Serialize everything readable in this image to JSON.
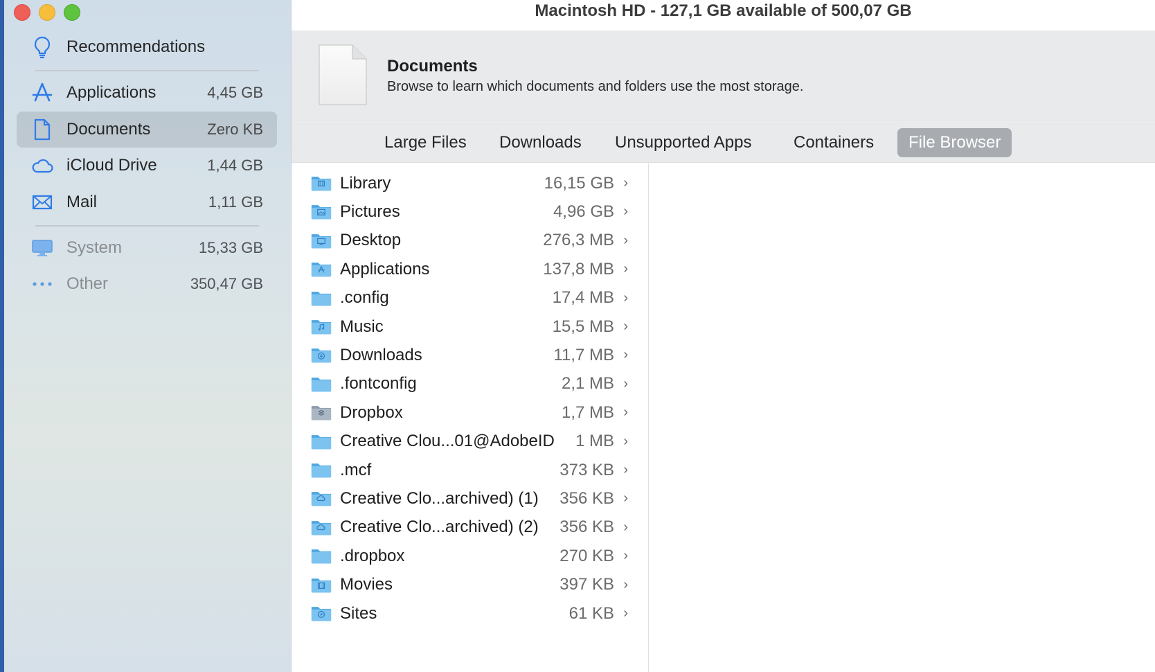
{
  "window": {
    "title": "Macintosh HD - 127,1 GB available of 500,07 GB"
  },
  "sidebar": {
    "recommendations": "Recommendations",
    "items": [
      {
        "label": "Applications",
        "size": "4,45 GB",
        "icon": "app-store-icon"
      },
      {
        "label": "Documents",
        "size": "Zero KB",
        "icon": "document-icon",
        "selected": true
      },
      {
        "label": "iCloud Drive",
        "size": "1,44 GB",
        "icon": "cloud-icon"
      },
      {
        "label": "Mail",
        "size": "1,11 GB",
        "icon": "envelope-icon"
      }
    ],
    "system_items": [
      {
        "label": "System",
        "size": "15,33 GB",
        "icon": "monitor-icon"
      },
      {
        "label": "Other",
        "size": "350,47 GB",
        "icon": "ellipsis-icon"
      }
    ]
  },
  "header": {
    "title": "Documents",
    "subtitle": "Browse to learn which documents and folders use the most storage."
  },
  "tabs": [
    {
      "label": "Large Files"
    },
    {
      "label": "Downloads"
    },
    {
      "label": "Unsupported Apps"
    },
    {
      "label": "Containers"
    },
    {
      "label": "File Browser",
      "active": true
    }
  ],
  "files": [
    {
      "name": "Library",
      "size": "16,15 GB",
      "icon": "library-folder-icon"
    },
    {
      "name": "Pictures",
      "size": "4,96 GB",
      "icon": "pictures-folder-icon"
    },
    {
      "name": "Desktop",
      "size": "276,3 MB",
      "icon": "desktop-folder-icon"
    },
    {
      "name": "Applications",
      "size": "137,8 MB",
      "icon": "applications-folder-icon"
    },
    {
      "name": ".config",
      "size": "17,4 MB",
      "icon": "folder-icon"
    },
    {
      "name": "Music",
      "size": "15,5 MB",
      "icon": "music-folder-icon"
    },
    {
      "name": "Downloads",
      "size": "11,7 MB",
      "icon": "downloads-folder-icon"
    },
    {
      "name": ".fontconfig",
      "size": "2,1 MB",
      "icon": "folder-icon"
    },
    {
      "name": "Dropbox",
      "size": "1,7 MB",
      "icon": "dropbox-folder-icon"
    },
    {
      "name": "Creative Clou...01@AdobeID",
      "size": "1 MB",
      "icon": "folder-icon"
    },
    {
      "name": ".mcf",
      "size": "373 KB",
      "icon": "folder-icon"
    },
    {
      "name": "Creative Clo...archived) (1)",
      "size": "356 KB",
      "icon": "creative-cloud-folder-icon"
    },
    {
      "name": "Creative Clo...archived) (2)",
      "size": "356 KB",
      "icon": "creative-cloud-folder-icon"
    },
    {
      "name": ".dropbox",
      "size": "270 KB",
      "icon": "folder-icon"
    },
    {
      "name": "Movies",
      "size": "397 KB",
      "icon": "movies-folder-icon"
    },
    {
      "name": "Sites",
      "size": "61 KB",
      "icon": "sites-folder-icon"
    }
  ],
  "chevron": "›",
  "colors": {
    "accent": "#2f7be8",
    "folder": "#6db8ec",
    "selected_tab": "#a8acb1"
  }
}
